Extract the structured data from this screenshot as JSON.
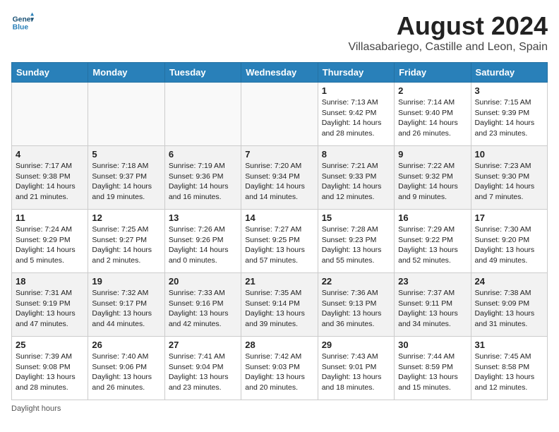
{
  "header": {
    "logo_line1": "General",
    "logo_line2": "Blue",
    "month_title": "August 2024",
    "location": "Villasabariego, Castille and Leon, Spain"
  },
  "weekdays": [
    "Sunday",
    "Monday",
    "Tuesday",
    "Wednesday",
    "Thursday",
    "Friday",
    "Saturday"
  ],
  "weeks": [
    [
      {
        "day": "",
        "info": ""
      },
      {
        "day": "",
        "info": ""
      },
      {
        "day": "",
        "info": ""
      },
      {
        "day": "",
        "info": ""
      },
      {
        "day": "1",
        "info": "Sunrise: 7:13 AM\nSunset: 9:42 PM\nDaylight: 14 hours and 28 minutes."
      },
      {
        "day": "2",
        "info": "Sunrise: 7:14 AM\nSunset: 9:40 PM\nDaylight: 14 hours and 26 minutes."
      },
      {
        "day": "3",
        "info": "Sunrise: 7:15 AM\nSunset: 9:39 PM\nDaylight: 14 hours and 23 minutes."
      }
    ],
    [
      {
        "day": "4",
        "info": "Sunrise: 7:17 AM\nSunset: 9:38 PM\nDaylight: 14 hours and 21 minutes."
      },
      {
        "day": "5",
        "info": "Sunrise: 7:18 AM\nSunset: 9:37 PM\nDaylight: 14 hours and 19 minutes."
      },
      {
        "day": "6",
        "info": "Sunrise: 7:19 AM\nSunset: 9:36 PM\nDaylight: 14 hours and 16 minutes."
      },
      {
        "day": "7",
        "info": "Sunrise: 7:20 AM\nSunset: 9:34 PM\nDaylight: 14 hours and 14 minutes."
      },
      {
        "day": "8",
        "info": "Sunrise: 7:21 AM\nSunset: 9:33 PM\nDaylight: 14 hours and 12 minutes."
      },
      {
        "day": "9",
        "info": "Sunrise: 7:22 AM\nSunset: 9:32 PM\nDaylight: 14 hours and 9 minutes."
      },
      {
        "day": "10",
        "info": "Sunrise: 7:23 AM\nSunset: 9:30 PM\nDaylight: 14 hours and 7 minutes."
      }
    ],
    [
      {
        "day": "11",
        "info": "Sunrise: 7:24 AM\nSunset: 9:29 PM\nDaylight: 14 hours and 5 minutes."
      },
      {
        "day": "12",
        "info": "Sunrise: 7:25 AM\nSunset: 9:27 PM\nDaylight: 14 hours and 2 minutes."
      },
      {
        "day": "13",
        "info": "Sunrise: 7:26 AM\nSunset: 9:26 PM\nDaylight: 14 hours and 0 minutes."
      },
      {
        "day": "14",
        "info": "Sunrise: 7:27 AM\nSunset: 9:25 PM\nDaylight: 13 hours and 57 minutes."
      },
      {
        "day": "15",
        "info": "Sunrise: 7:28 AM\nSunset: 9:23 PM\nDaylight: 13 hours and 55 minutes."
      },
      {
        "day": "16",
        "info": "Sunrise: 7:29 AM\nSunset: 9:22 PM\nDaylight: 13 hours and 52 minutes."
      },
      {
        "day": "17",
        "info": "Sunrise: 7:30 AM\nSunset: 9:20 PM\nDaylight: 13 hours and 49 minutes."
      }
    ],
    [
      {
        "day": "18",
        "info": "Sunrise: 7:31 AM\nSunset: 9:19 PM\nDaylight: 13 hours and 47 minutes."
      },
      {
        "day": "19",
        "info": "Sunrise: 7:32 AM\nSunset: 9:17 PM\nDaylight: 13 hours and 44 minutes."
      },
      {
        "day": "20",
        "info": "Sunrise: 7:33 AM\nSunset: 9:16 PM\nDaylight: 13 hours and 42 minutes."
      },
      {
        "day": "21",
        "info": "Sunrise: 7:35 AM\nSunset: 9:14 PM\nDaylight: 13 hours and 39 minutes."
      },
      {
        "day": "22",
        "info": "Sunrise: 7:36 AM\nSunset: 9:13 PM\nDaylight: 13 hours and 36 minutes."
      },
      {
        "day": "23",
        "info": "Sunrise: 7:37 AM\nSunset: 9:11 PM\nDaylight: 13 hours and 34 minutes."
      },
      {
        "day": "24",
        "info": "Sunrise: 7:38 AM\nSunset: 9:09 PM\nDaylight: 13 hours and 31 minutes."
      }
    ],
    [
      {
        "day": "25",
        "info": "Sunrise: 7:39 AM\nSunset: 9:08 PM\nDaylight: 13 hours and 28 minutes."
      },
      {
        "day": "26",
        "info": "Sunrise: 7:40 AM\nSunset: 9:06 PM\nDaylight: 13 hours and 26 minutes."
      },
      {
        "day": "27",
        "info": "Sunrise: 7:41 AM\nSunset: 9:04 PM\nDaylight: 13 hours and 23 minutes."
      },
      {
        "day": "28",
        "info": "Sunrise: 7:42 AM\nSunset: 9:03 PM\nDaylight: 13 hours and 20 minutes."
      },
      {
        "day": "29",
        "info": "Sunrise: 7:43 AM\nSunset: 9:01 PM\nDaylight: 13 hours and 18 minutes."
      },
      {
        "day": "30",
        "info": "Sunrise: 7:44 AM\nSunset: 8:59 PM\nDaylight: 13 hours and 15 minutes."
      },
      {
        "day": "31",
        "info": "Sunrise: 7:45 AM\nSunset: 8:58 PM\nDaylight: 13 hours and 12 minutes."
      }
    ]
  ],
  "footer": {
    "note": "Daylight hours"
  }
}
